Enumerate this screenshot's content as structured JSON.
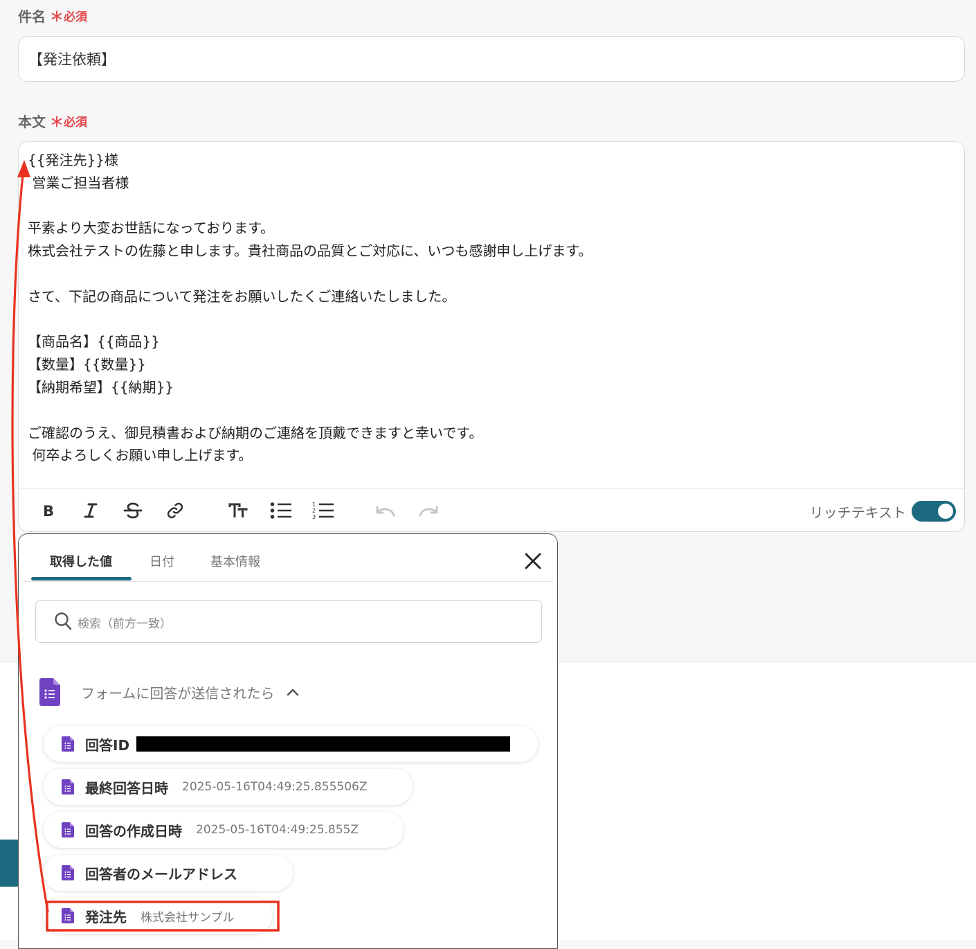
{
  "subject": {
    "label": "件名",
    "required_mark": "＊",
    "required_text": "必須",
    "value": "【発注依頼】"
  },
  "body": {
    "label": "本文",
    "required_mark": "＊",
    "required_text": "必須",
    "lines": [
      "{{発注先}}様",
      " 営業ご担当者様",
      "",
      "平素より大変お世話になっております。",
      "株式会社テストの佐藤と申します。貴社商品の品質とご対応に、いつも感謝申し上げます。",
      "",
      "さて、下記の商品について発注をお願いしたくご連絡いたしました。",
      "",
      "【商品名】{{商品}}",
      "【数量】{{数量}}",
      "【納期希望】{{納期}}",
      "",
      "ご確認のうえ、御見積書および納期のご連絡を頂戴できますと幸いです。",
      " 何卒よろしくお願い申し上げます。"
    ]
  },
  "toolbar": {
    "rich_text_label": "リッチテキスト",
    "rich_text_enabled": true,
    "icons": [
      "bold-icon",
      "italic-icon",
      "strikethrough-icon",
      "link-icon",
      "text-size-icon",
      "bulleted-list-icon",
      "numbered-list-icon",
      "undo-icon",
      "redo-icon"
    ],
    "accent_color": "#1b6a80"
  },
  "popup": {
    "tabs": [
      "取得した値",
      "日付",
      "基本情報"
    ],
    "active_tab": "取得した値",
    "search_placeholder": "検索（前方一致）",
    "group_label": "フォームに回答が送信されたら",
    "items": [
      {
        "label": "回答ID",
        "value": "",
        "redacted": true
      },
      {
        "label": "最終回答日時",
        "value": "2025-05-16T04:49:25.855506Z"
      },
      {
        "label": "回答の作成日時",
        "value": "2025-05-16T04:49:25.855Z"
      },
      {
        "label": "回答者のメールアドレス",
        "value": ""
      },
      {
        "label": "発注先",
        "value": "株式会社サンプル",
        "highlighted": true
      }
    ]
  },
  "annotation_color": "#e8321f"
}
